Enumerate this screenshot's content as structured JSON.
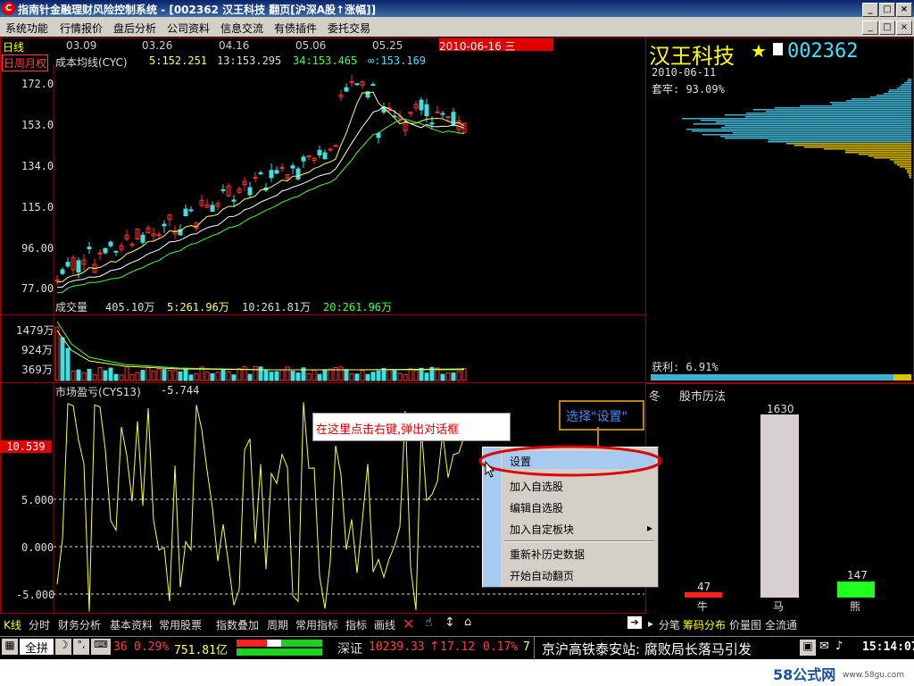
{
  "window": {
    "title": "指南针金融理财风险控制系统 - [002362 汉王科技 翻页[沪深A股↑涨幅]]",
    "logo_text": "C",
    "buttons": [
      "_",
      "□",
      "×"
    ]
  },
  "menu": {
    "items": [
      "系统功能",
      "行情报价",
      "盘后分析",
      "公司资料",
      "信息交流",
      "有债插件",
      "委托交易"
    ],
    "mdi_buttons": [
      "_",
      "□",
      "×"
    ]
  },
  "kline": {
    "period_label": "日线",
    "period_switch": "日周月权",
    "date_labels": [
      "03.09",
      "03.26",
      "04.16",
      "05.06",
      "05.25"
    ],
    "current_date": "2010-06-16 三",
    "indicator_name": "成本均线(CYC)",
    "ma5": "5:152.251",
    "ma13": "13:153.295",
    "ma34": "34:153.465",
    "ma_inf": "∞:153.169",
    "y_ticks": [
      "172.0",
      "153.0",
      "134.0",
      "115.0",
      "96.00",
      "77.00"
    ]
  },
  "volume": {
    "label": "成交量",
    "value": "405.10万",
    "ma5": "5:261.96万",
    "ma10": "10:261.81万",
    "ma20": "20:261.96万",
    "y_ticks": [
      "1479万",
      "924万",
      "369万"
    ]
  },
  "indicator": {
    "name": "市场盈亏(CYS13)",
    "value": "-5.744",
    "current_tag": "10.539",
    "y_ticks": [
      "5.000",
      "0.000",
      "-5.000"
    ]
  },
  "annotation": {
    "right_click_hint": "在这里点击右键,弹出对话框",
    "select_hint": "选择\"设置\""
  },
  "context_menu": {
    "items": [
      "设置",
      "加入自选股",
      "编辑自选股",
      "加入自定板块",
      "重新补历史数据",
      "开始自动翻页"
    ],
    "submenu_arrow": "▸"
  },
  "stock": {
    "name": "汉王科技",
    "code": "002362",
    "date": "2010-06-11",
    "trapped_label": "套牢: 93.09%",
    "profit_label": "获利: 6.91%"
  },
  "calendar": {
    "title": "股市历法",
    "season": "冬",
    "bull_label": "牛",
    "horse_label": "马",
    "bear_label": "熊",
    "bull_value": "47",
    "horse_value": "1630",
    "bear_value": "147",
    "colors": {
      "bull": "#ff2020",
      "horse": "#d8d0d0",
      "bear": "#20ff20"
    }
  },
  "bottom_tabs": {
    "left": [
      "K线",
      "分时",
      "财务分析",
      "基本资料",
      "常用股票"
    ],
    "middle": [
      "指数叠加",
      "周期",
      "常用指标",
      "指标",
      "画线"
    ],
    "right": [
      "分笔",
      "筹码分布",
      "价量图",
      "全流通"
    ]
  },
  "status": {
    "btn1": "全拼",
    "sh_change": "36",
    "sh_pct": "0.29%",
    "sh_amount": "751.81亿",
    "sz_label": "深证",
    "sz_index": "10239.33",
    "sz_change": "17.12",
    "sz_pct": "0.17%",
    "sz_count": "7",
    "news": "京沪高铁泰安站: 腐败局长落马引发",
    "time": "15:14:07"
  },
  "watermark": {
    "text": "58公式网",
    "url": "www.58gu.com"
  }
}
